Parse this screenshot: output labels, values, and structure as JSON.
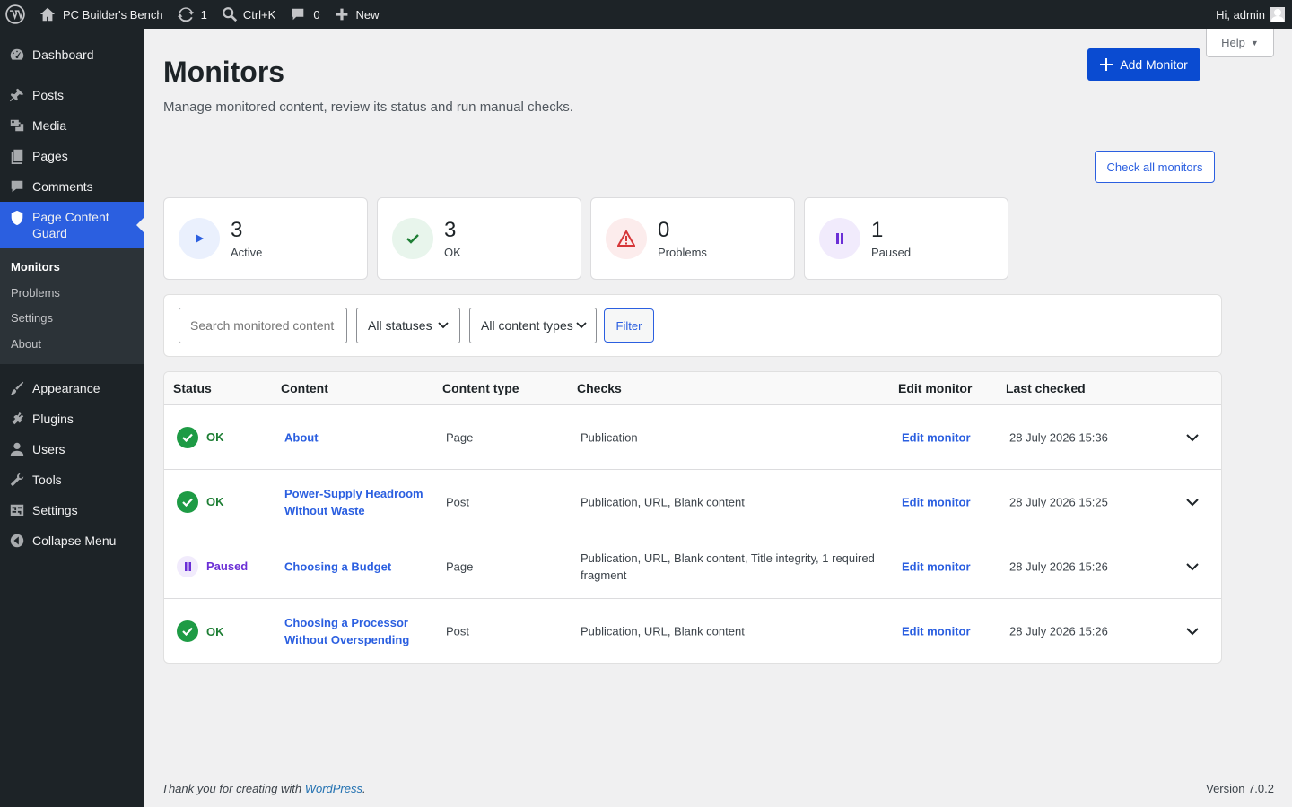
{
  "adminbar": {
    "site_name": "PC Builder's Bench",
    "updates_count": "1",
    "search_shortcut": "Ctrl+K",
    "comments_count": "0",
    "new_label": "New",
    "greeting": "Hi, admin"
  },
  "sidebar": {
    "items": [
      {
        "label": "Dashboard",
        "icon": "dashboard-icon"
      },
      {
        "label": "Posts",
        "icon": "pin-icon"
      },
      {
        "label": "Media",
        "icon": "media-icon"
      },
      {
        "label": "Pages",
        "icon": "pages-icon"
      },
      {
        "label": "Comments",
        "icon": "comments-icon"
      },
      {
        "label": "Page Content Guard",
        "icon": "shield-icon"
      },
      {
        "label": "Appearance",
        "icon": "brush-icon"
      },
      {
        "label": "Plugins",
        "icon": "plugin-icon"
      },
      {
        "label": "Users",
        "icon": "users-icon"
      },
      {
        "label": "Tools",
        "icon": "wrench-icon"
      },
      {
        "label": "Settings",
        "icon": "settings-icon"
      },
      {
        "label": "Collapse Menu",
        "icon": "collapse-icon"
      }
    ],
    "submenu": [
      "Monitors",
      "Problems",
      "Settings",
      "About"
    ]
  },
  "header": {
    "title": "Monitors",
    "description": "Manage monitored content, review its status and run manual checks.",
    "help_label": "Help",
    "add_button": "Add Monitor",
    "check_all_button": "Check all monitors"
  },
  "stats": [
    {
      "value": "3",
      "label": "Active",
      "color": "#2b5fe0",
      "bg": "#eaf0fd"
    },
    {
      "value": "3",
      "label": "OK",
      "color": "#1e7e34",
      "bg": "#e8f5ec"
    },
    {
      "value": "0",
      "label": "Problems",
      "color": "#d63638",
      "bg": "#fcecec"
    },
    {
      "value": "1",
      "label": "Paused",
      "color": "#6b2fd6",
      "bg": "#f1ebfc"
    }
  ],
  "filters": {
    "search_placeholder": "Search monitored content",
    "status_select": "All statuses",
    "type_select": "All content types",
    "filter_button": "Filter"
  },
  "table": {
    "columns": [
      "Status",
      "Content",
      "Content type",
      "Checks",
      "Edit monitor",
      "Last checked"
    ],
    "rows": [
      {
        "status": "OK",
        "content": "About",
        "type": "Page",
        "checks": "Publication",
        "edit": "Edit monitor",
        "last": "28 July 2026 15:36"
      },
      {
        "status": "OK",
        "content": "Power-Supply Headroom Without Waste",
        "type": "Post",
        "checks": "Publication, URL, Blank content",
        "edit": "Edit monitor",
        "last": "28 July 2026 15:25"
      },
      {
        "status": "Paused",
        "content": "Choosing a Budget",
        "type": "Page",
        "checks": "Publication, URL, Blank content, Title integrity, 1 required fragment",
        "edit": "Edit monitor",
        "last": "28 July 2026 15:26"
      },
      {
        "status": "OK",
        "content": "Choosing a Processor Without Overspending",
        "type": "Post",
        "checks": "Publication, URL, Blank content",
        "edit": "Edit monitor",
        "last": "28 July 2026 15:26"
      }
    ]
  },
  "footer": {
    "thanks_prefix": "Thank you for creating with ",
    "thanks_link": "WordPress",
    "thanks_suffix": ".",
    "version": "Version 7.0.2"
  }
}
